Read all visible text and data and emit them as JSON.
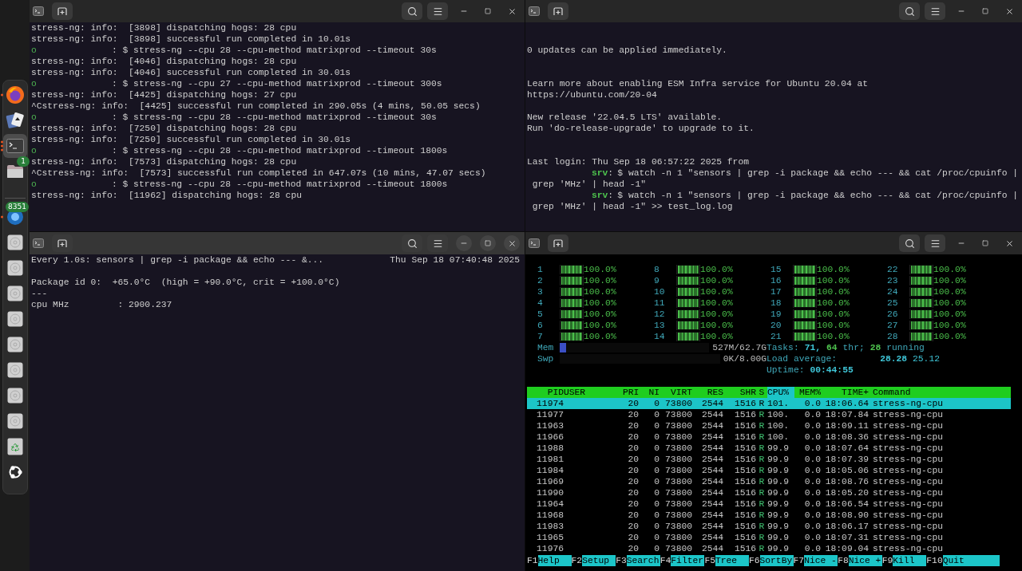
{
  "dock": {
    "items": [
      {
        "kind": "browser",
        "active": false,
        "running": true
      },
      {
        "kind": "cards",
        "active": false,
        "running": false
      },
      {
        "kind": "terminal",
        "active": true,
        "running": true
      },
      {
        "kind": "files",
        "active": false,
        "running": false,
        "badge": "1"
      },
      {
        "kind": "separator"
      },
      {
        "kind": "app",
        "active": false,
        "running": true,
        "badge": "8351"
      },
      {
        "kind": "disc",
        "active": false,
        "running": false
      },
      {
        "kind": "disc",
        "active": false,
        "running": false
      },
      {
        "kind": "disc",
        "active": false,
        "running": false
      },
      {
        "kind": "disc",
        "active": false,
        "running": false
      },
      {
        "kind": "disc",
        "active": false,
        "running": false
      },
      {
        "kind": "disc",
        "active": false,
        "running": false
      },
      {
        "kind": "disc",
        "active": false,
        "running": false
      },
      {
        "kind": "disc",
        "active": false,
        "running": false
      },
      {
        "kind": "trash",
        "active": false,
        "running": false
      },
      {
        "kind": "ubuntu",
        "active": false,
        "running": false
      }
    ]
  },
  "windows": [
    {
      "kind": "log",
      "focused": false,
      "lines": [
        {
          "kind": "output",
          "text": "stress-ng: info:  [3898] dispatching hogs: 28 cpu"
        },
        {
          "kind": "output",
          "text": "stress-ng: info:  [3898] successful run completed in 10.01s"
        },
        {
          "kind": "prompt",
          "marker": "o",
          "command": ": $ stress-ng --cpu 28 --cpu-method matrixprod --timeout 30s"
        },
        {
          "kind": "output",
          "text": "stress-ng: info:  [4046] dispatching hogs: 28 cpu"
        },
        {
          "kind": "output",
          "text": "stress-ng: info:  [4046] successful run completed in 30.01s"
        },
        {
          "kind": "prompt",
          "marker": "o",
          "command": ": $ stress-ng --cpu 27 --cpu-method matrixprod --timeout 300s"
        },
        {
          "kind": "output",
          "text": "stress-ng: info:  [4425] dispatching hogs: 27 cpu"
        },
        {
          "kind": "output",
          "text": "^Cstress-ng: info:  [4425] successful run completed in 290.05s (4 mins, 50.05 secs)"
        },
        {
          "kind": "prompt",
          "marker": "o",
          "command": ": $ stress-ng --cpu 28 --cpu-method matrixprod --timeout 30s"
        },
        {
          "kind": "output",
          "text": "stress-ng: info:  [7250] dispatching hogs: 28 cpu"
        },
        {
          "kind": "output",
          "text": "stress-ng: info:  [7250] successful run completed in 30.01s"
        },
        {
          "kind": "prompt",
          "marker": "o",
          "command": ": $ stress-ng --cpu 28 --cpu-method matrixprod --timeout 1800s"
        },
        {
          "kind": "output",
          "text": "stress-ng: info:  [7573] dispatching hogs: 28 cpu"
        },
        {
          "kind": "output",
          "text": "^Cstress-ng: info:  [7573] successful run completed in 647.07s (10 mins, 47.07 secs)"
        },
        {
          "kind": "prompt",
          "marker": "o",
          "command": ": $ stress-ng --cpu 28 --cpu-method matrixprod --timeout 1800s"
        },
        {
          "kind": "output",
          "text": "stress-ng: info:  [11962] dispatching hogs: 28 cpu"
        }
      ]
    },
    {
      "kind": "motd",
      "focused": false,
      "blocks": [
        {
          "lines": [
            {
              "kind": "blank"
            },
            {
              "kind": "blank"
            },
            {
              "kind": "output",
              "text": "0 updates can be applied immediately."
            }
          ]
        },
        {
          "lines": [
            {
              "kind": "blank"
            },
            {
              "kind": "blank"
            },
            {
              "kind": "output",
              "text": "Learn more about enabling ESM Infra service for Ubuntu 20.04 at"
            },
            {
              "kind": "output",
              "text": "https://ubuntu.com/20-04"
            }
          ]
        },
        {
          "lines": [
            {
              "kind": "blank"
            },
            {
              "kind": "output",
              "text": "New release '22.04.5 LTS' available."
            },
            {
              "kind": "output",
              "text": "Run 'do-release-upgrade' to upgrade to it."
            }
          ]
        },
        {
          "lines": [
            {
              "kind": "blank"
            },
            {
              "kind": "blank"
            },
            {
              "kind": "output",
              "text": "Last login: Thu Sep 18 06:57:22 2025 from"
            },
            {
              "kind": "prompt",
              "host": "srv",
              "separator": ":",
              "command": "$ watch -n 1 \"sensors | grep -i package && echo --- && cat /proc/cpuinfo |"
            },
            {
              "kind": "output",
              "text": " grep 'MHz' | head -1\""
            },
            {
              "kind": "prompt",
              "host": "srv",
              "separator": ":",
              "command": "$ watch -n 1 \"sensors | grep -i package && echo --- && cat /proc/cpuinfo |"
            },
            {
              "kind": "output",
              "text": " grep 'MHz' | head -1\" >> test_log.log"
            }
          ]
        }
      ]
    },
    {
      "kind": "watch",
      "focused": true,
      "command": "Every 1.0s: sensors | grep -i package && echo --- &...",
      "time": "Thu Sep 18 07:40:48 2025",
      "lines": [
        {
          "kind": "output",
          "text": "Package id 0:  +65.0°C  (high = +90.0°C, crit = +100.0°C)"
        },
        {
          "kind": "output",
          "text": "---"
        },
        {
          "kind": "output",
          "text": "cpu MHz         : 2900.237"
        }
      ]
    },
    {
      "kind": "htop",
      "focused": false,
      "cpu_columns": [
        [
          {
            "label": "1",
            "level": 1,
            "reading": "100.0%"
          },
          {
            "label": "2",
            "level": 1,
            "reading": "100.0%"
          },
          {
            "label": "3",
            "level": 1,
            "reading": "100.0%"
          },
          {
            "label": "4",
            "level": 1,
            "reading": "100.0%"
          },
          {
            "label": "5",
            "level": 1,
            "reading": "100.0%"
          },
          {
            "label": "6",
            "level": 1,
            "reading": "100.0%"
          },
          {
            "label": "7",
            "level": 1,
            "reading": "100.0%"
          }
        ],
        [
          {
            "label": "8",
            "level": 1,
            "reading": "100.0%"
          },
          {
            "label": "9",
            "level": 1,
            "reading": "100.0%"
          },
          {
            "label": "10",
            "level": 1,
            "reading": "100.0%"
          },
          {
            "label": "11",
            "level": 1,
            "reading": "100.0%"
          },
          {
            "label": "12",
            "level": 1,
            "reading": "100.0%"
          },
          {
            "label": "13",
            "level": 1,
            "reading": "100.0%"
          },
          {
            "label": "14",
            "level": 1,
            "reading": "100.0%"
          }
        ],
        [
          {
            "label": "15",
            "level": 1,
            "reading": "100.0%"
          },
          {
            "label": "16",
            "level": 1,
            "reading": "100.0%"
          },
          {
            "label": "17",
            "level": 1,
            "reading": "100.0%"
          },
          {
            "label": "18",
            "level": 1,
            "reading": "100.0%"
          },
          {
            "label": "19",
            "level": 1,
            "reading": "100.0%"
          },
          {
            "label": "20",
            "level": 1,
            "reading": "100.0%"
          },
          {
            "label": "21",
            "level": 1,
            "reading": "100.0%"
          }
        ],
        [
          {
            "label": "22",
            "level": 1,
            "reading": "100.0%"
          },
          {
            "label": "23",
            "level": 1,
            "reading": "100.0%"
          },
          {
            "label": "24",
            "level": 1,
            "reading": "100.0%"
          },
          {
            "label": "25",
            "level": 1,
            "reading": "100.0%"
          },
          {
            "label": "26",
            "level": 1,
            "reading": "100.0%"
          },
          {
            "label": "27",
            "level": 1,
            "reading": "100.0%"
          },
          {
            "label": "28",
            "level": 1,
            "reading": "100.0%"
          }
        ]
      ],
      "memory": [
        {
          "label": "Mem",
          "level": 0.01,
          "reading": "527M/62.7G"
        },
        {
          "label": "Swp",
          "level": 0,
          "reading": "0K/8.00G"
        }
      ],
      "tasks": {
        "label": "Tasks:",
        "count": "71,",
        "threads": "64",
        "threads_label": "thr;",
        "running": "28",
        "running_label": "running"
      },
      "load": {
        "label": "Load average:",
        "values": [
          "28.28",
          "25.12"
        ]
      },
      "uptime": {
        "label": "Uptime:",
        "value": "00:44:55"
      },
      "columns": [
        {
          "label": "PID",
          "sorted": false
        },
        {
          "label": "USER",
          "sorted": false
        },
        {
          "label": "PRI",
          "sorted": false
        },
        {
          "label": "NI",
          "sorted": false
        },
        {
          "label": "VIRT",
          "sorted": false
        },
        {
          "label": "RES",
          "sorted": false
        },
        {
          "label": "SHR",
          "sorted": false
        },
        {
          "label": "S",
          "sorted": false
        },
        {
          "label": "CPU%",
          "sorted": true
        },
        {
          "label": "MEM%",
          "sorted": false
        },
        {
          "label": "TIME+",
          "sorted": false
        },
        {
          "label": "Command",
          "sorted": false
        }
      ],
      "rows": [
        {
          "selected": true,
          "pid": "11974",
          "pri": "20",
          "ni": "0",
          "virt": "73800",
          "res": "2544",
          "shr": "1516",
          "state": "R",
          "cpu": "101.",
          "mem": "0.0",
          "time": "18:06.64",
          "command": "stress-ng-cpu"
        },
        {
          "selected": false,
          "pid": "11977",
          "pri": "20",
          "ni": "0",
          "virt": "73800",
          "res": "2544",
          "shr": "1516",
          "state": "R",
          "cpu": "100.",
          "mem": "0.0",
          "time": "18:07.84",
          "command": "stress-ng-cpu"
        },
        {
          "selected": false,
          "pid": "11963",
          "pri": "20",
          "ni": "0",
          "virt": "73800",
          "res": "2544",
          "shr": "1516",
          "state": "R",
          "cpu": "100.",
          "mem": "0.0",
          "time": "18:09.11",
          "command": "stress-ng-cpu"
        },
        {
          "selected": false,
          "pid": "11966",
          "pri": "20",
          "ni": "0",
          "virt": "73800",
          "res": "2544",
          "shr": "1516",
          "state": "R",
          "cpu": "100.",
          "mem": "0.0",
          "time": "18:08.36",
          "command": "stress-ng-cpu"
        },
        {
          "selected": false,
          "pid": "11988",
          "pri": "20",
          "ni": "0",
          "virt": "73800",
          "res": "2544",
          "shr": "1516",
          "state": "R",
          "cpu": "99.9",
          "mem": "0.0",
          "time": "18:07.64",
          "command": "stress-ng-cpu"
        },
        {
          "selected": false,
          "pid": "11981",
          "pri": "20",
          "ni": "0",
          "virt": "73800",
          "res": "2544",
          "shr": "1516",
          "state": "R",
          "cpu": "99.9",
          "mem": "0.0",
          "time": "18:07.39",
          "command": "stress-ng-cpu"
        },
        {
          "selected": false,
          "pid": "11984",
          "pri": "20",
          "ni": "0",
          "virt": "73800",
          "res": "2544",
          "shr": "1516",
          "state": "R",
          "cpu": "99.9",
          "mem": "0.0",
          "time": "18:05.06",
          "command": "stress-ng-cpu"
        },
        {
          "selected": false,
          "pid": "11969",
          "pri": "20",
          "ni": "0",
          "virt": "73800",
          "res": "2544",
          "shr": "1516",
          "state": "R",
          "cpu": "99.9",
          "mem": "0.0",
          "time": "18:08.76",
          "command": "stress-ng-cpu"
        },
        {
          "selected": false,
          "pid": "11990",
          "pri": "20",
          "ni": "0",
          "virt": "73800",
          "res": "2544",
          "shr": "1516",
          "state": "R",
          "cpu": "99.9",
          "mem": "0.0",
          "time": "18:05.20",
          "command": "stress-ng-cpu"
        },
        {
          "selected": false,
          "pid": "11964",
          "pri": "20",
          "ni": "0",
          "virt": "73800",
          "res": "2544",
          "shr": "1516",
          "state": "R",
          "cpu": "99.9",
          "mem": "0.0",
          "time": "18:06.54",
          "command": "stress-ng-cpu"
        },
        {
          "selected": false,
          "pid": "11968",
          "pri": "20",
          "ni": "0",
          "virt": "73800",
          "res": "2544",
          "shr": "1516",
          "state": "R",
          "cpu": "99.9",
          "mem": "0.0",
          "time": "18:08.90",
          "command": "stress-ng-cpu"
        },
        {
          "selected": false,
          "pid": "11983",
          "pri": "20",
          "ni": "0",
          "virt": "73800",
          "res": "2544",
          "shr": "1516",
          "state": "R",
          "cpu": "99.9",
          "mem": "0.0",
          "time": "18:06.17",
          "command": "stress-ng-cpu"
        },
        {
          "selected": false,
          "pid": "11965",
          "pri": "20",
          "ni": "0",
          "virt": "73800",
          "res": "2544",
          "shr": "1516",
          "state": "R",
          "cpu": "99.9",
          "mem": "0.0",
          "time": "18:07.31",
          "command": "stress-ng-cpu"
        },
        {
          "selected": false,
          "pid": "11976",
          "pri": "20",
          "ni": "0",
          "virt": "73800",
          "res": "2544",
          "shr": "1516",
          "state": "R",
          "cpu": "99.9",
          "mem": "0.0",
          "time": "18:09.04",
          "command": "stress-ng-cpu"
        }
      ],
      "function_keys": [
        {
          "key": "F1",
          "label": "Help"
        },
        {
          "key": "F2",
          "label": "Setup"
        },
        {
          "key": "F3",
          "label": "Search"
        },
        {
          "key": "F4",
          "label": "Filter"
        },
        {
          "key": "F5",
          "label": "Tree"
        },
        {
          "key": "F6",
          "label": "SortBy"
        },
        {
          "key": "F7",
          "label": "Nice -"
        },
        {
          "key": "F8",
          "label": "Nice +"
        },
        {
          "key": "F9",
          "label": "Kill"
        },
        {
          "key": "F10",
          "label": "Quit"
        }
      ]
    }
  ]
}
